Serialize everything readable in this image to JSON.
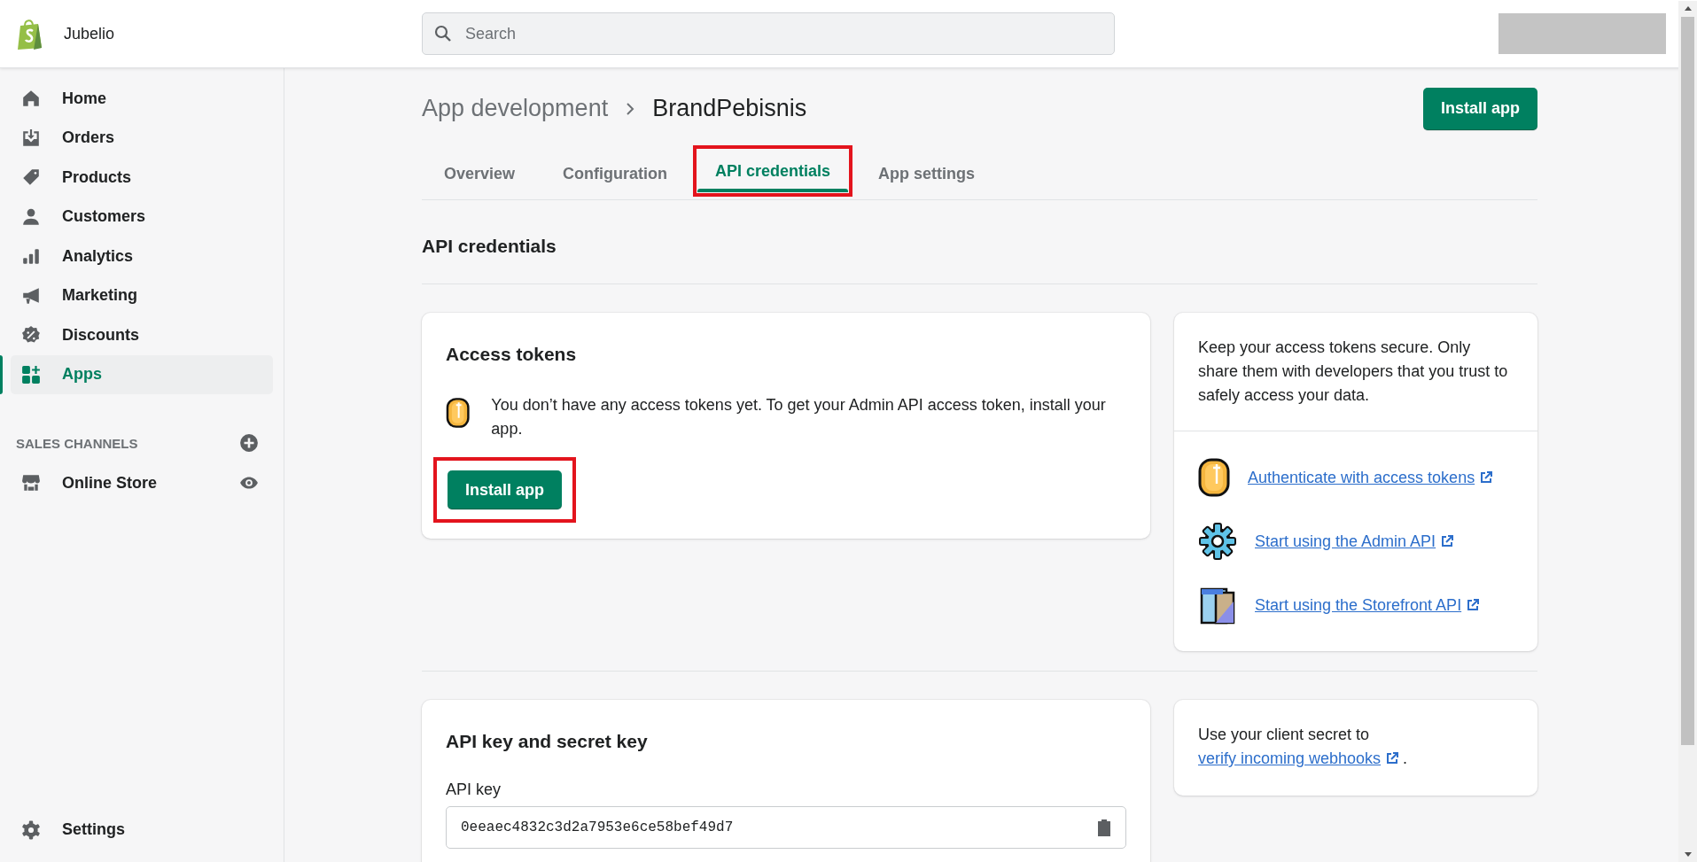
{
  "store": {
    "name": "Jubelio"
  },
  "search": {
    "placeholder": "Search"
  },
  "nav": [
    {
      "label": "Home",
      "kind": "home",
      "selected": false
    },
    {
      "label": "Orders",
      "kind": "orders",
      "selected": false
    },
    {
      "label": "Products",
      "kind": "tag",
      "selected": false
    },
    {
      "label": "Customers",
      "kind": "person",
      "selected": false
    },
    {
      "label": "Analytics",
      "kind": "bars",
      "selected": false
    },
    {
      "label": "Marketing",
      "kind": "megaphone",
      "selected": false
    },
    {
      "label": "Discounts",
      "kind": "discount",
      "selected": false
    },
    {
      "label": "Apps",
      "kind": "apps",
      "selected": true
    }
  ],
  "sales_channels": {
    "heading": "SALES CHANNELS",
    "items": [
      {
        "label": "Online Store"
      }
    ]
  },
  "settings": {
    "label": "Settings"
  },
  "breadcrumb": {
    "parent": "App development",
    "current": "BrandPebisnis"
  },
  "header_button": {
    "label": "Install app"
  },
  "tabs": [
    {
      "label": "Overview",
      "selected": false,
      "highlighted": false
    },
    {
      "label": "Configuration",
      "selected": false,
      "highlighted": false
    },
    {
      "label": "API credentials",
      "selected": true,
      "highlighted": true
    },
    {
      "label": "App settings",
      "selected": false,
      "highlighted": false
    }
  ],
  "section_title": "API credentials",
  "access_tokens": {
    "title": "Access tokens",
    "message": "You don’t have any access tokens yet. To get your Admin API access token, install your app.",
    "button": {
      "label": "Install app",
      "highlighted": true
    }
  },
  "tips": {
    "text": "Keep your access tokens secure. Only share them with developers that you trust to safely access your data.",
    "links": [
      {
        "label": "Authenticate with access tokens",
        "kind": "coin"
      },
      {
        "label": "Start using the Admin API",
        "kind": "gear"
      },
      {
        "label": "Start using the Storefront API",
        "kind": "storefront"
      }
    ]
  },
  "api_keys": {
    "title": "API key and secret key",
    "field_label": "API key",
    "value": "0eeaec4832c3d2a7953e6ce58bef49d7"
  },
  "webhook_note": {
    "text": "Use your client secret to",
    "link": "verify incoming webhooks",
    "end": "."
  }
}
